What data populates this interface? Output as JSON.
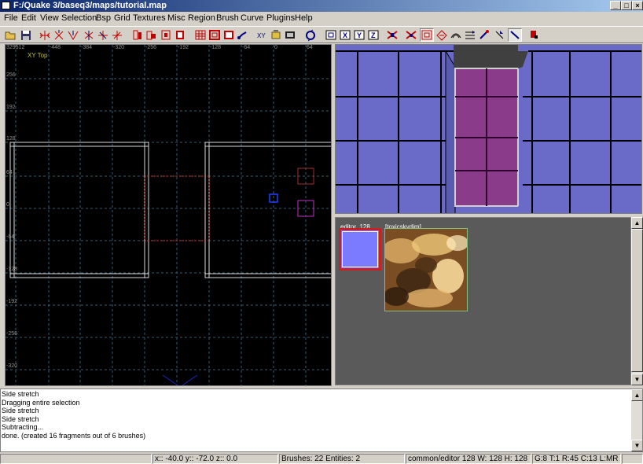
{
  "window": {
    "title": "F:/Quake 3/baseq3/maps/tutorial.map",
    "min_glyph": "_",
    "max_glyph": "□",
    "close_glyph": "×"
  },
  "menu": [
    "File",
    "Edit",
    "View",
    "Selection",
    "Bsp",
    "Grid",
    "Textures",
    "Misc",
    "Region",
    "Brush",
    "Curve",
    "Plugins",
    "Help"
  ],
  "toolbar": {
    "buttons": [
      "open-icon",
      "save-icon",
      "flip-x-icon",
      "flip-y-icon",
      "flip-z-icon",
      "rotate-x-icon",
      "rotate-y-icon",
      "rotate-z-icon",
      "select-complete-tall-icon",
      "select-touching-icon",
      "select-partial-tall-icon",
      "select-inside-icon",
      "csg-subtract-icon",
      "csg-hollow-icon",
      "csg-merge-icon",
      "clipper-icon",
      "free-rotation-icon",
      "free-scaling-icon",
      "camera-icon",
      "change-views-icon",
      "view-top-icon",
      "view-x-icon",
      "view-y-icon",
      "view-z-icon",
      "texture-lock-icon",
      "rotate-lock-icon",
      "show-patch-bounding-icon",
      "patch-wireframe-icon",
      "patch-bend-icon",
      "patch-tessellation-icon",
      "insert-patch-points-icon",
      "drop-patch-icon",
      "curve-cap-icon",
      "entity-icon",
      "plugin-icon"
    ],
    "axis_labels": {
      "x": "X",
      "y": "Y",
      "z": "Z"
    }
  },
  "view2d": {
    "title": "XY Top",
    "top_ticks": [
      "329512",
      "-448",
      "-384",
      "-320",
      "-256",
      "-192",
      "-128",
      "-64",
      "0",
      "64"
    ],
    "left_ticks": [
      "256",
      "192",
      "128",
      "64",
      "0",
      "-64",
      "-128",
      "-192",
      "-256",
      "-320"
    ]
  },
  "texture_panel": {
    "items": [
      {
        "name": "editor_128",
        "selected": true,
        "color": "#7b7bff"
      },
      {
        "name": "[toxicskydim]",
        "selected": false
      }
    ]
  },
  "console": {
    "lines": [
      "Side stretch",
      "Dragging entire selection",
      "Side stretch",
      "Side stretch",
      "Subtracting...",
      "done. (created 16 fragments out of 6 brushes)"
    ]
  },
  "status": {
    "coords": "x:: -40.0  y:: -72.0  z:: 0.0",
    "counts": "Brushes: 22 Entities: 2",
    "texture": "common/editor  128 W: 128 H: 128",
    "grid": "G:8 T:1 R:45 C:13 L:MR"
  },
  "colors": {
    "titlebar": "#0a246a",
    "grid_line": "#2f5f7a",
    "brush_line": "#d8d8d8",
    "selection": "#e03030",
    "view3d_wall": "#6a6ac8",
    "view3d_floor": "#8a3c8a"
  }
}
